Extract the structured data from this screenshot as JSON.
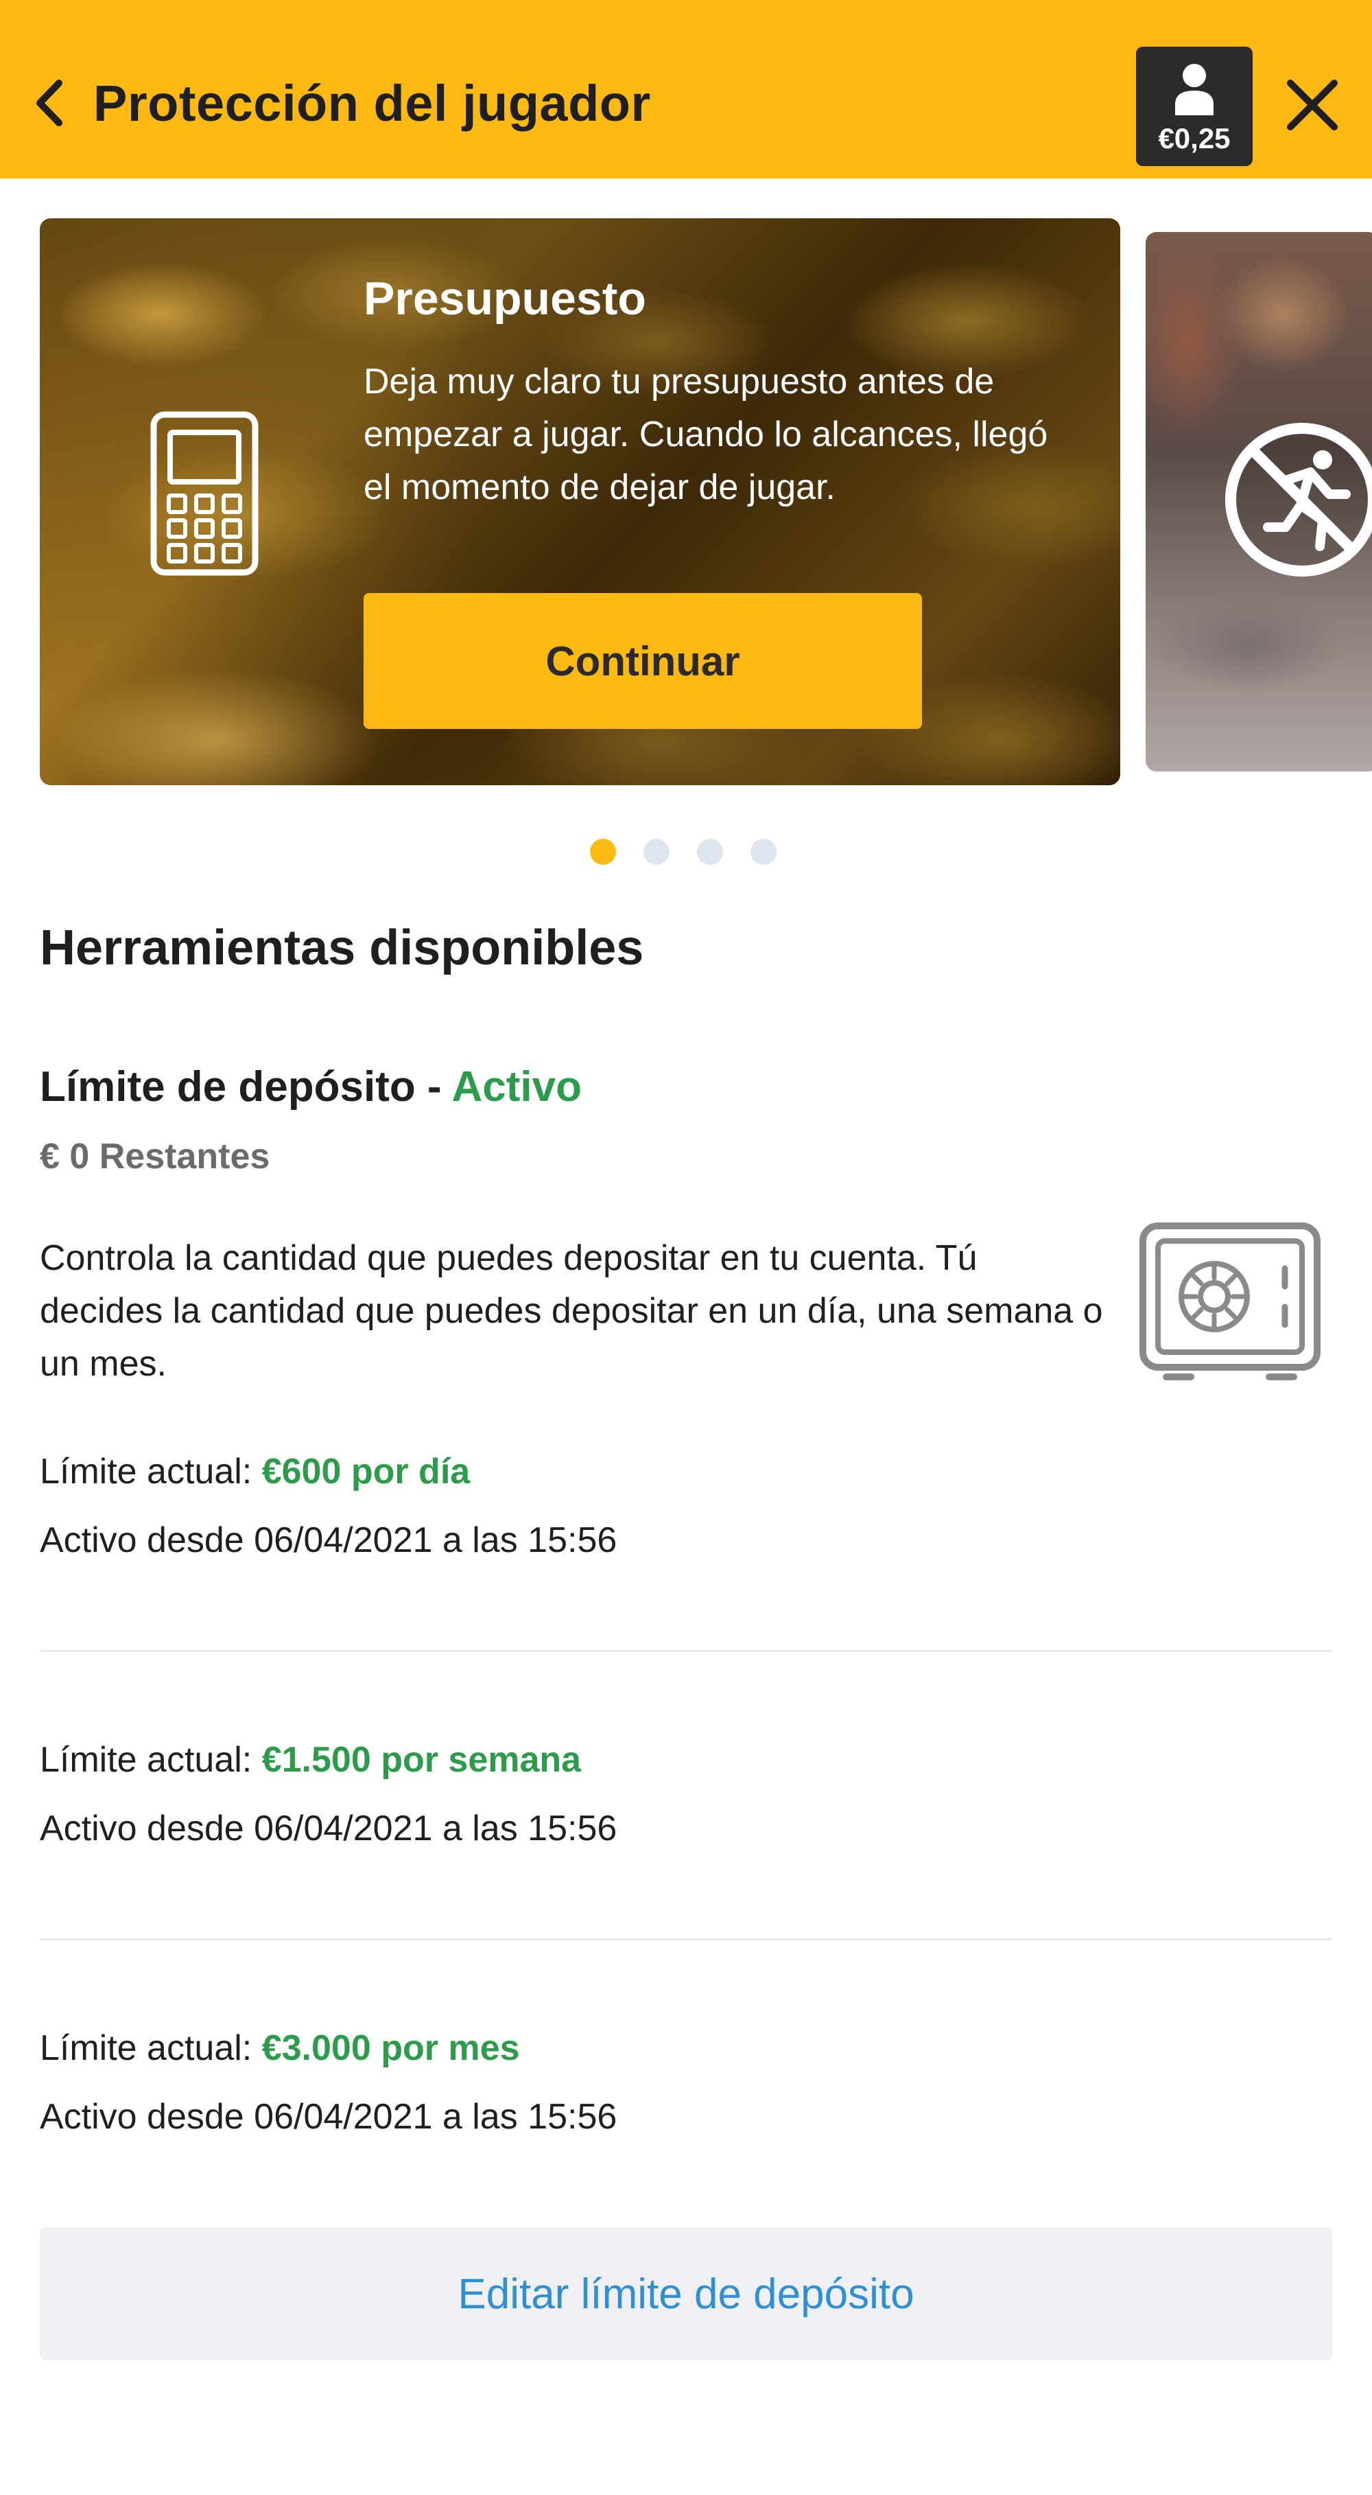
{
  "header": {
    "title": "Protección del jugador",
    "balance": "€0,25",
    "bg_color": "#fbb912"
  },
  "carousel": {
    "card": {
      "title": "Presupuesto",
      "description": "Deja muy claro tu presupuesto antes de empezar a jugar. Cuando lo alcances, llegó el momento de dejar de jugar.",
      "button_label": "Continuar",
      "icon": "calculator-icon"
    },
    "next_card_icon": "no-running-icon",
    "dots_count": 4,
    "active_dot": 1
  },
  "tools": {
    "section_title": "Herramientas disponibles",
    "deposit": {
      "title": "Límite de depósito - ",
      "status": "Activo",
      "remaining": "€ 0 Restantes",
      "description": "Controla la cantidad que puedes depositar en tu cuenta. Tú decides la cantidad que puedes depositar en un día, una semana o un mes.",
      "icon": "safe-icon",
      "limits": [
        {
          "label": "Límite actual: ",
          "value": "€600 por día",
          "since": "Activo desde 06/04/2021 a las 15:56"
        },
        {
          "label": "Límite actual: ",
          "value": "€1.500 por semana",
          "since": "Activo desde 06/04/2021 a las 15:56"
        },
        {
          "label": "Límite actual: ",
          "value": "€3.000 por mes",
          "since": "Activo desde 06/04/2021 a las 15:56"
        }
      ],
      "edit_button": "Editar límite de depósito"
    }
  },
  "colors": {
    "accent": "#fbb912",
    "active_green": "#2d9c4a",
    "link_blue": "#2e8fd6"
  }
}
